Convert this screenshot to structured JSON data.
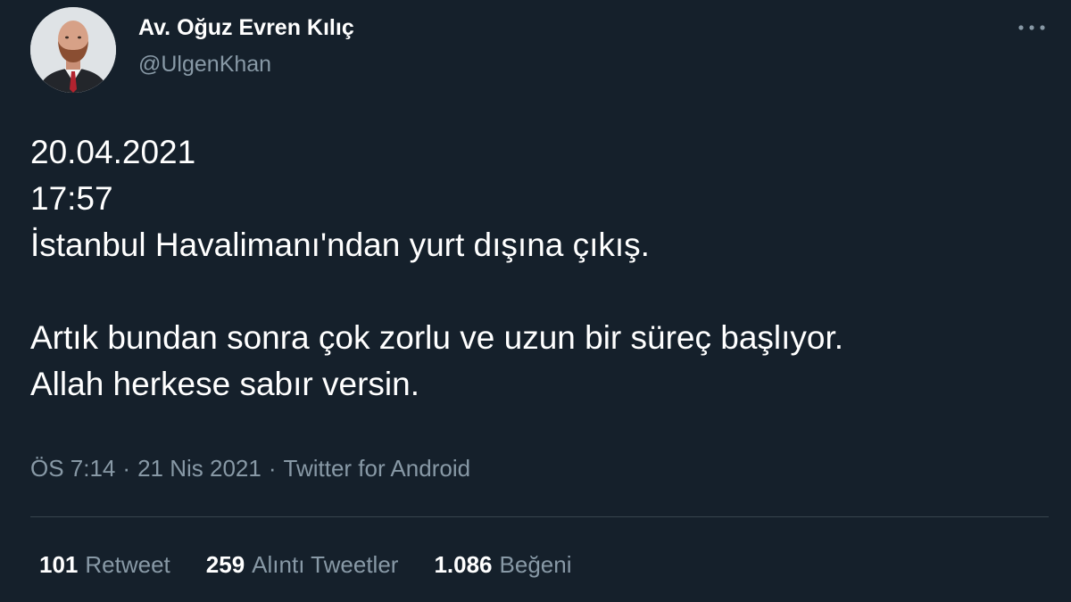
{
  "author": {
    "display_name": "Av. Oğuz Evren Kılıç",
    "handle": "@UlgenKhan"
  },
  "tweet": {
    "lines": [
      "20.04.2021",
      "17:57",
      "İstanbul Havalimanı'ndan yurt dışına çıkış.",
      "",
      "Artık bundan sonra çok zorlu ve uzun bir süreç başlıyor.",
      "Allah herkese sabır versin."
    ]
  },
  "meta": {
    "time": "ÖS 7:14",
    "date": "21 Nis 2021",
    "source": "Twitter for Android",
    "separator": "·"
  },
  "stats": {
    "retweets": {
      "count": "101",
      "label": "Retweet"
    },
    "quotes": {
      "count": "259",
      "label": "Alıntı Tweetler"
    },
    "likes": {
      "count": "1.086",
      "label": "Beğeni"
    }
  },
  "icons": {
    "more": "more-horizontal-icon"
  },
  "colors": {
    "background": "#15202b",
    "primary_text": "#ffffff",
    "secondary_text": "#8899a6",
    "divider": "#38444d"
  }
}
